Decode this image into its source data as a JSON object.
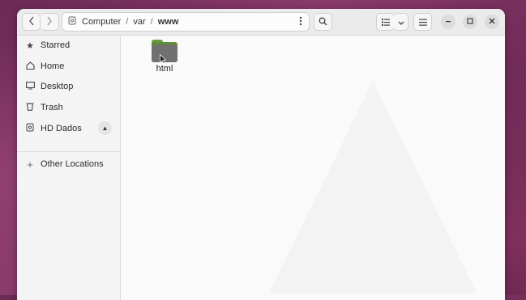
{
  "headerbar": {
    "back_icon": "chevron-left-icon",
    "forward_icon": "chevron-right-icon",
    "location_icon": "drive-icon",
    "breadcrumbs": [
      "Computer",
      "var",
      "www"
    ],
    "separator": "/",
    "path_menu_icon": "vertical-dots-icon",
    "search_icon": "search-icon",
    "view_icon": "list-view-icon",
    "view_dropdown_icon": "chevron-down-icon",
    "menu_icon": "hamburger-icon",
    "minimize_icon": "minimize-icon",
    "maximize_icon": "maximize-icon",
    "close_icon": "close-icon"
  },
  "sidebar": {
    "items": [
      {
        "label": "Starred",
        "icon": "star-icon"
      },
      {
        "label": "Home",
        "icon": "home-icon"
      },
      {
        "label": "Desktop",
        "icon": "desktop-icon"
      },
      {
        "label": "Trash",
        "icon": "trash-icon"
      },
      {
        "label": "HD Dados",
        "icon": "drive-icon",
        "eject_icon": "eject-icon"
      },
      {
        "label": "Other Locations",
        "icon": "plus-icon"
      }
    ]
  },
  "content": {
    "files": [
      {
        "name": "html",
        "type": "folder",
        "icon": "folder-icon"
      }
    ]
  },
  "colors": {
    "folder_green": "#5d8d36",
    "folder_grey": "#707070",
    "desktop_bg": "#6b2a55"
  }
}
